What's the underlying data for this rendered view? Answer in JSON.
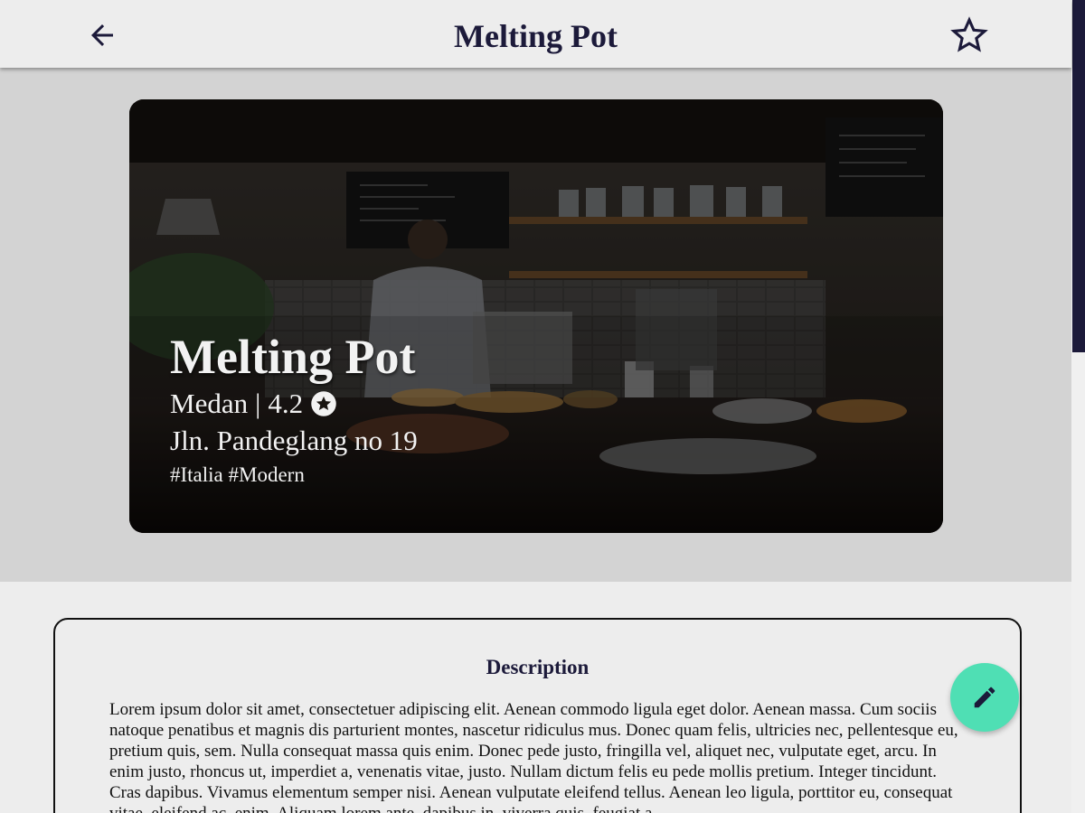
{
  "app_bar": {
    "title": "Melting Pot",
    "back_icon": "arrow-left-icon",
    "favorite_icon": "star-outline-icon"
  },
  "hero": {
    "name": "Melting Pot",
    "location": "Medan",
    "separator": "|",
    "rating": "4.2",
    "rating_icon": "star-circle-icon",
    "address": "Jln. Pandeglang no 19",
    "tags": "#Italia #Modern"
  },
  "description": {
    "title": "Description",
    "body": "Lorem ipsum dolor sit amet, consectetuer adipiscing elit. Aenean commodo ligula eget dolor. Aenean massa. Cum sociis natoque penatibus et magnis dis parturient montes, nascetur ridiculus mus. Donec quam felis, ultricies nec, pellentesque eu, pretium quis, sem. Nulla consequat massa quis enim. Donec pede justo, fringilla vel, aliquet nec, vulputate eget, arcu. In enim justo, rhoncus ut, imperdiet a, venenatis vitae, justo. Nullam dictum felis eu pede mollis pretium. Integer tincidunt. Cras dapibus. Vivamus elementum semper nisi. Aenean vulputate eleifend tellus. Aenean leo ligula, porttitor eu, consequat vitae, eleifend ac, enim. Aliquam lorem ante, dapibus in, viverra quis, feugiat a,"
  },
  "fab": {
    "icon": "pencil-icon"
  },
  "colors": {
    "primary_dark": "#1c1a3a",
    "accent": "#4fdfb4",
    "background": "#ededed",
    "hero_background": "#d3d3d3"
  }
}
